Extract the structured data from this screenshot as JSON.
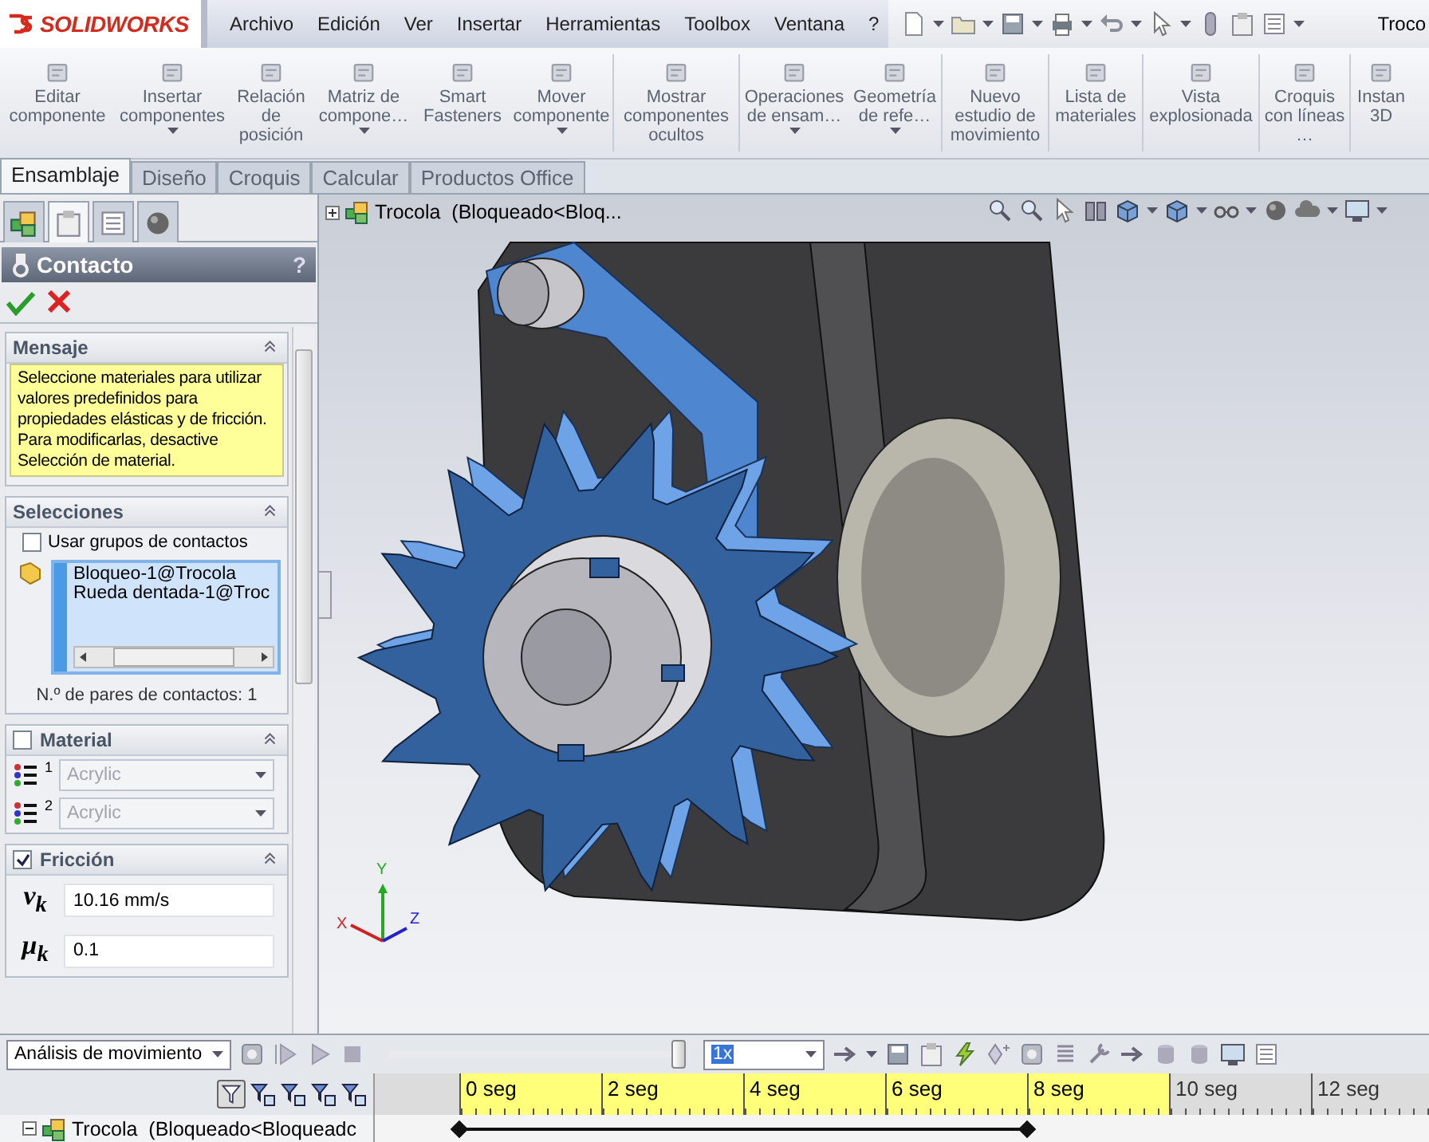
{
  "app": {
    "logo": "SOLIDWORKS",
    "document_title": "Troco"
  },
  "menu": [
    "Archivo",
    "Edición",
    "Ver",
    "Insertar",
    "Herramientas",
    "Toolbox",
    "Ventana",
    "?"
  ],
  "ribbon": [
    {
      "label": "Editar componente",
      "dropdown": false
    },
    {
      "label": "Insertar componentes",
      "dropdown": true
    },
    {
      "label": "Relación de posición",
      "dropdown": false
    },
    {
      "label": "Matriz de compone…",
      "dropdown": true
    },
    {
      "label": "Smart Fasteners",
      "dropdown": false
    },
    {
      "label": "Mover componente",
      "dropdown": true
    },
    {
      "label": "Mostrar componentes ocultos",
      "dropdown": false
    },
    {
      "label": "Operaciones de ensam…",
      "dropdown": true
    },
    {
      "label": "Geometría de refe…",
      "dropdown": true
    },
    {
      "label": "Nuevo estudio de movimiento",
      "dropdown": false
    },
    {
      "label": "Lista de materiales",
      "dropdown": false
    },
    {
      "label": "Vista explosionada",
      "dropdown": false
    },
    {
      "label": "Croquis con líneas …",
      "dropdown": false
    },
    {
      "label": "Instan 3D",
      "dropdown": false
    }
  ],
  "tabs": [
    {
      "label": "Ensamblaje",
      "selected": true
    },
    {
      "label": "Diseño",
      "selected": false
    },
    {
      "label": "Croquis",
      "selected": false
    },
    {
      "label": "Calcular",
      "selected": false
    },
    {
      "label": "Productos Office",
      "selected": false
    }
  ],
  "panel": {
    "icon_tabs": [
      {
        "selected": false
      },
      {
        "selected": true
      },
      {
        "selected": false
      },
      {
        "selected": false
      }
    ],
    "title": "Contacto",
    "help": "?",
    "sections": [
      {
        "kind": "message",
        "title": "Mensaje",
        "text": "Seleccione materiales para utilizar valores predefinidos para propiedades elásticas y de fricción. Para modificarlas, desactive Selección de material."
      },
      {
        "kind": "selections",
        "title": "Selecciones",
        "option": {
          "label": "Usar grupos de contactos",
          "checked": false
        },
        "items": [
          "Bloqueo-1@Trocola",
          "Rueda dentada-1@Troc"
        ],
        "count_text": "N.º de pares de contactos: 1"
      },
      {
        "kind": "material",
        "title": "Material",
        "checked": false,
        "fields": [
          {
            "badge": "1",
            "value": "Acrylic",
            "disabled": true
          },
          {
            "badge": "2",
            "value": "Acrylic",
            "disabled": true
          }
        ]
      },
      {
        "kind": "friction",
        "title": "Fricción",
        "checked": true,
        "fields": [
          {
            "symbol": "v$_{k}$",
            "value": "10.16 mm/s"
          },
          {
            "symbol": "μ$_{k}$",
            "value": "0.1"
          }
        ]
      }
    ]
  },
  "viewport": {
    "tree_item": {
      "label": "Trocola  (Bloqueado<Bloq...",
      "expanded": false
    },
    "axes": [
      "Y",
      "X",
      "Z"
    ]
  },
  "motion": {
    "study_type": "Análisis de movimiento",
    "playback": {
      "level": 1.0
    },
    "speed": "1x",
    "ruler": [
      {
        "label": "0 seg",
        "in_range": true
      },
      {
        "label": "2 seg",
        "in_range": true
      },
      {
        "label": "4 seg",
        "in_range": true
      },
      {
        "label": "6 seg",
        "in_range": true
      },
      {
        "label": "8 seg",
        "in_range": true
      },
      {
        "label": "10 seg",
        "in_range": false
      },
      {
        "label": "12 seg",
        "in_range": false
      }
    ],
    "rows": [
      {
        "label": "Trocola  (Bloqueado<Bloqueadc",
        "expanded": true
      }
    ]
  }
}
